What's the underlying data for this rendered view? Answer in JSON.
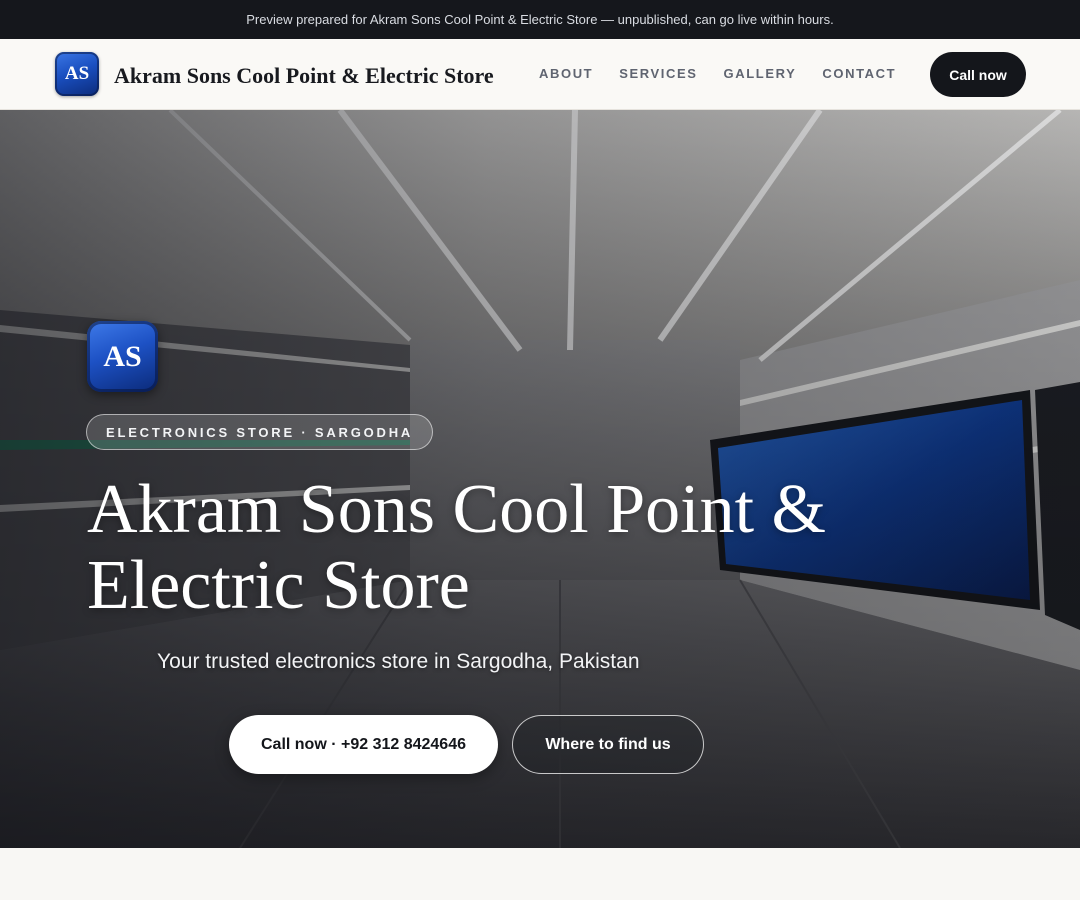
{
  "preview_bar": {
    "text": "Preview prepared for Akram Sons Cool Point & Electric Store — unpublished, can go live within hours."
  },
  "header": {
    "logo_text": "AS",
    "brand_name": "Akram Sons Cool Point & Electric Store",
    "nav": [
      "ABOUT",
      "SERVICES",
      "GALLERY",
      "CONTACT"
    ],
    "cta_label": "Call now"
  },
  "hero": {
    "logo_text": "AS",
    "pill": "ELECTRONICS STORE · SARGODHA",
    "title": "Akram Sons Cool Point & Electric Store",
    "subtitle": "Your trusted electronics store in Sargodha, Pakistan",
    "primary_button": "Call now · +92 312 8424646",
    "secondary_button": "Where to find us"
  },
  "colors": {
    "dark": "#14161b",
    "logo_blue": "#1d51c4",
    "page_bg": "#f8f7f4"
  }
}
